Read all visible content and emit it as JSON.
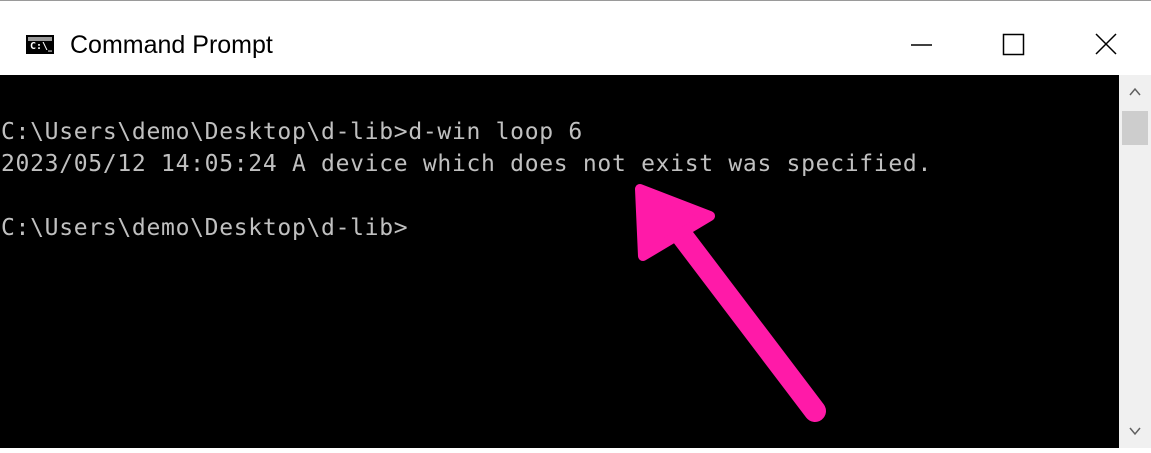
{
  "window": {
    "title": "Command Prompt",
    "icon": "cmd-icon",
    "icon_glyph": "C:\\_"
  },
  "controls": {
    "minimize": "minimize-icon",
    "maximize": "maximize-icon",
    "close": "close-icon"
  },
  "console": {
    "lines": [
      "C:\\Users\\demo\\Desktop\\d-lib>d-win loop 6",
      "2023/05/12 14:05:24 A device which does not exist was specified.",
      "C:\\Users\\demo\\Desktop\\d-lib>"
    ],
    "text_color": "#c0c0c0",
    "background": "#000000"
  },
  "annotation": {
    "icon": "arrow-annotation",
    "color": "#ff1aa8"
  },
  "scrollbar": {
    "up_icon": "chevron-up-icon",
    "down_icon": "chevron-down-icon"
  }
}
